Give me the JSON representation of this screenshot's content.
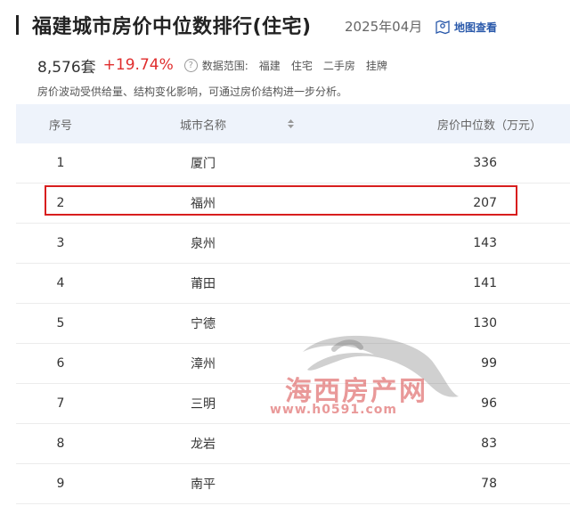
{
  "header": {
    "title": "福建城市房价中位数排行(住宅)",
    "date": "2025年04月",
    "map_link": "地图查看"
  },
  "stats": {
    "count": "8,576套",
    "change": "+19.74%",
    "scope_label": "数据范围:",
    "scope_tags": [
      "福建",
      "住宅",
      "二手房",
      "挂牌"
    ]
  },
  "note": "房价波动受供给量、结构变化影响，可通过房价结构进一步分析。",
  "table": {
    "headers": {
      "rank": "序号",
      "city": "城市名称",
      "price": "房价中位数（万元）"
    },
    "rows": [
      {
        "rank": "1",
        "city": "厦门",
        "price": "336"
      },
      {
        "rank": "2",
        "city": "福州",
        "price": "207"
      },
      {
        "rank": "3",
        "city": "泉州",
        "price": "143"
      },
      {
        "rank": "4",
        "city": "莆田",
        "price": "141"
      },
      {
        "rank": "5",
        "city": "宁德",
        "price": "130"
      },
      {
        "rank": "6",
        "city": "漳州",
        "price": "99"
      },
      {
        "rank": "7",
        "city": "三明",
        "price": "96"
      },
      {
        "rank": "8",
        "city": "龙岩",
        "price": "83"
      },
      {
        "rank": "9",
        "city": "南平",
        "price": "78"
      }
    ]
  },
  "watermark": {
    "name": "海西房产网",
    "url": "www.h0591.com"
  },
  "colors": {
    "accent": "#e02d2d",
    "link": "#2b5aab",
    "header_bg": "#eef3fb",
    "highlight_border": "#d81e1e"
  }
}
